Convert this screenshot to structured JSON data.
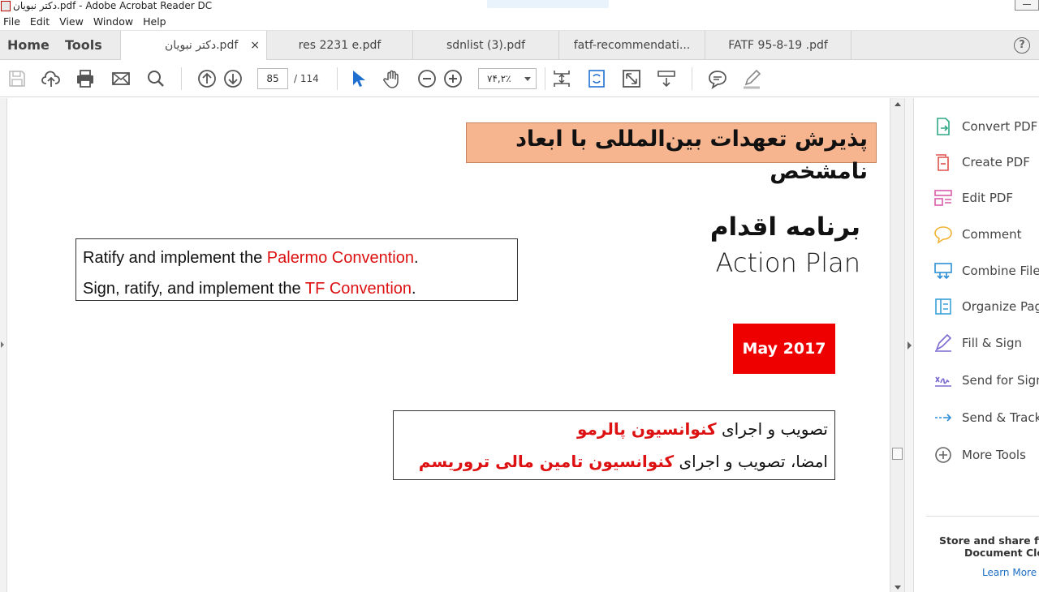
{
  "window": {
    "title": "دکتر نبویان.pdf - Adobe Acrobat Reader DC"
  },
  "menu": [
    "File",
    "Edit",
    "View",
    "Window",
    "Help"
  ],
  "nav_tabs": {
    "home": "Home",
    "tools": "Tools"
  },
  "doc_tabs": [
    {
      "label": "دکتر نبویان.pdf",
      "active": true,
      "close": "×"
    },
    {
      "label": "res 2231 e.pdf",
      "active": false
    },
    {
      "label": "sdnlist (3).pdf",
      "active": false
    },
    {
      "label": "fatf-recommendati...",
      "active": false
    },
    {
      "label": "FATF  95-8-19  .pdf",
      "active": false
    }
  ],
  "help_icon": "?",
  "toolbar": {
    "page_current": "85",
    "page_total": "/ 114",
    "zoom": "۷۴,۲٪"
  },
  "document": {
    "banner_fa": "پذیرش تعهدات بین‌المللی با ابعاد نامشخص",
    "heading_fa": "برنامه اقدام",
    "heading_en": "Action Plan",
    "en_box": {
      "line1_pre": "Ratify and implement the ",
      "line1_red": "Palermo Convention",
      "line1_post": ".",
      "line2_pre": "Sign, ratify, and implement the ",
      "line2_red": "TF Convention",
      "line2_post": "."
    },
    "date": "May 2017",
    "fa_box": {
      "line1_pre": "تصویب و اجرای ",
      "line1_red": "کنوانسیون پالرمو",
      "line2_pre": "امضا، تصویب و اجرای ",
      "line2_red": "کنوانسیون تامین مالی تروریسم"
    }
  },
  "right_panel": {
    "items": [
      {
        "label": "Convert PDF",
        "icon": "convert-pdf-icon",
        "color": "#2fa887"
      },
      {
        "label": "Create PDF",
        "icon": "create-pdf-icon",
        "color": "#e0514b"
      },
      {
        "label": "Edit PDF",
        "icon": "edit-pdf-icon",
        "color": "#d95ca8"
      },
      {
        "label": "Comment",
        "icon": "comment-icon",
        "color": "#f2b233"
      },
      {
        "label": "Combine Files",
        "icon": "combine-files-icon",
        "color": "#2f8fd6"
      },
      {
        "label": "Organize Pages",
        "icon": "organize-pages-icon",
        "color": "#3aa0d8"
      },
      {
        "label": "Fill & Sign",
        "icon": "fill-sign-icon",
        "color": "#7a6bd1"
      },
      {
        "label": "Send for Signature",
        "icon": "send-signature-icon",
        "color": "#7a6bd1"
      },
      {
        "label": "Send & Track",
        "icon": "send-track-icon",
        "color": "#2f8fd6"
      },
      {
        "label": "More Tools",
        "icon": "more-tools-icon",
        "color": "#666666"
      }
    ],
    "promo": [
      "Store and share files",
      "Document Cloud"
    ],
    "learn_more": "Learn More"
  }
}
